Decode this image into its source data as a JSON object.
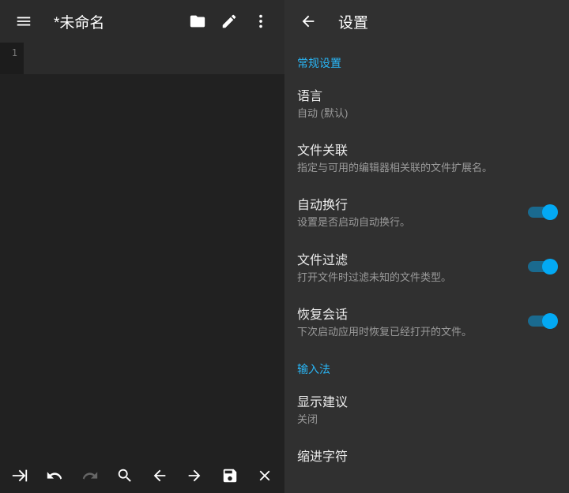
{
  "left": {
    "title": "*未命名",
    "gutter_line": "1"
  },
  "right": {
    "header": "设置",
    "section_general": "常规设置",
    "items": [
      {
        "title": "语言",
        "sub": "自动 (默认)"
      },
      {
        "title": "文件关联",
        "sub": "指定与可用的编辑器相关联的文件扩展名。"
      },
      {
        "title": "自动换行",
        "sub": "设置是否启动自动换行。"
      },
      {
        "title": "文件过滤",
        "sub": "打开文件时过滤未知的文件类型。"
      },
      {
        "title": "恢复会话",
        "sub": "下次启动应用时恢复已经打开的文件。"
      }
    ],
    "section_ime": "输入法",
    "ime_items": [
      {
        "title": "显示建议",
        "sub": "关闭"
      },
      {
        "title": "缩进字符",
        "sub": ""
      }
    ]
  }
}
